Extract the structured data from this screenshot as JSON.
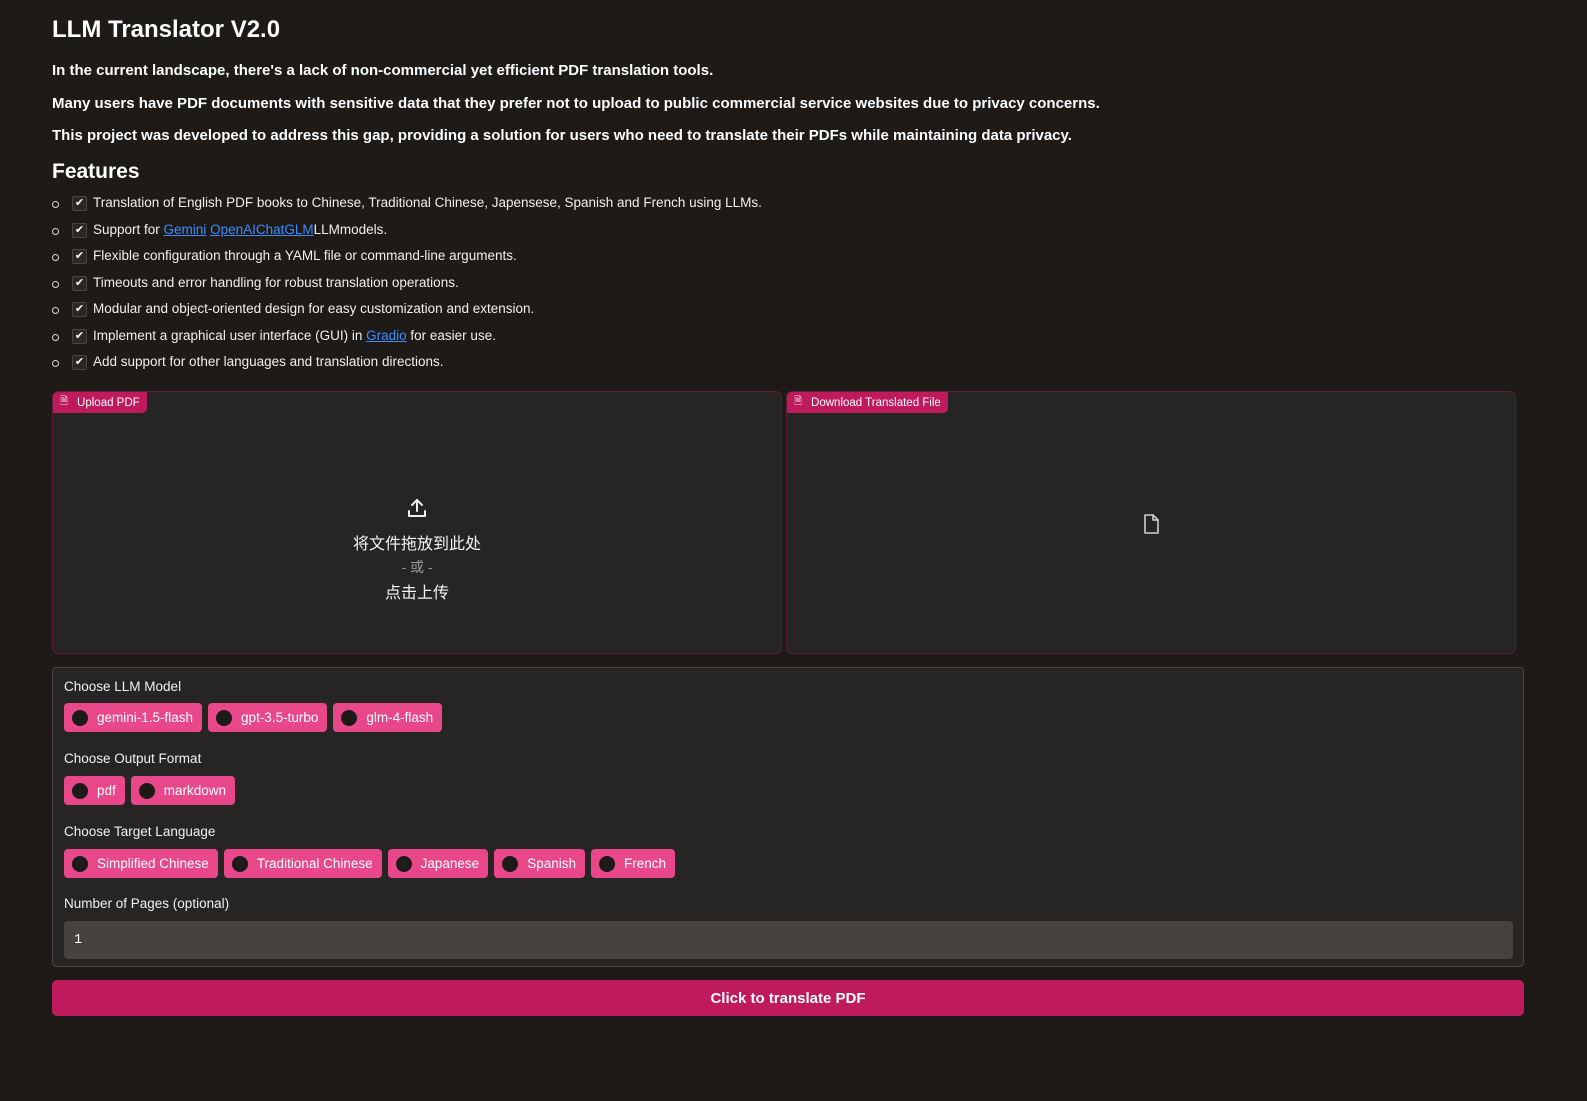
{
  "header": {
    "title": "LLM Translator V2.0",
    "intro": [
      "In the current landscape, there's a lack of non-commercial yet efficient PDF translation tools.",
      "Many users have PDF documents with sensitive data that they prefer not to upload to public commercial service websites due to privacy concerns.",
      "This project was developed to address this gap, providing a solution for users who need to translate their PDFs while maintaining data privacy."
    ]
  },
  "features": {
    "heading": "Features",
    "items": [
      {
        "text": "Translation of English PDF books to Chinese, Traditional Chinese, Japensese, Spanish and French using LLMs."
      },
      {
        "pre": "Support for ",
        "links": [
          "Gemini",
          "OpenAI",
          "ChatGLM"
        ],
        "post": "LLMmodels."
      },
      {
        "text": "Flexible configuration through a YAML file or command-line arguments."
      },
      {
        "text": "Timeouts and error handling for robust translation operations."
      },
      {
        "text": "Modular and object-oriented design for easy customization and extension."
      },
      {
        "pre": "Implement a graphical user interface (GUI) in ",
        "link": "Gradio",
        "post": " for easier use."
      },
      {
        "text": "Add support for other languages and translation directions."
      }
    ],
    "check_glyph": "✔"
  },
  "upload": {
    "tag": "Upload PDF",
    "drop_text": "将文件拖放到此处",
    "or_text": "- 或 -",
    "click_text": "点击上传",
    "icon": "upload-icon"
  },
  "download": {
    "tag": "Download Translated File",
    "icon": "file-icon"
  },
  "options": {
    "model_label": "Choose LLM Model",
    "models": [
      "gemini-1.5-flash",
      "gpt-3.5-turbo",
      "glm-4-flash"
    ],
    "format_label": "Choose Output Format",
    "formats": [
      "pdf",
      "markdown"
    ],
    "language_label": "Choose Target Language",
    "languages": [
      "Simplified Chinese",
      "Traditional Chinese",
      "Japanese",
      "Spanish",
      "French"
    ],
    "pages_label": "Number of Pages (optional)",
    "pages_value": "1"
  },
  "actions": {
    "translate_label": "Click to translate PDF"
  },
  "colors": {
    "background": "#1d1a18",
    "accent": "#bf1a5c",
    "radio_bg": "#e8488a",
    "link": "#3d8bff"
  }
}
